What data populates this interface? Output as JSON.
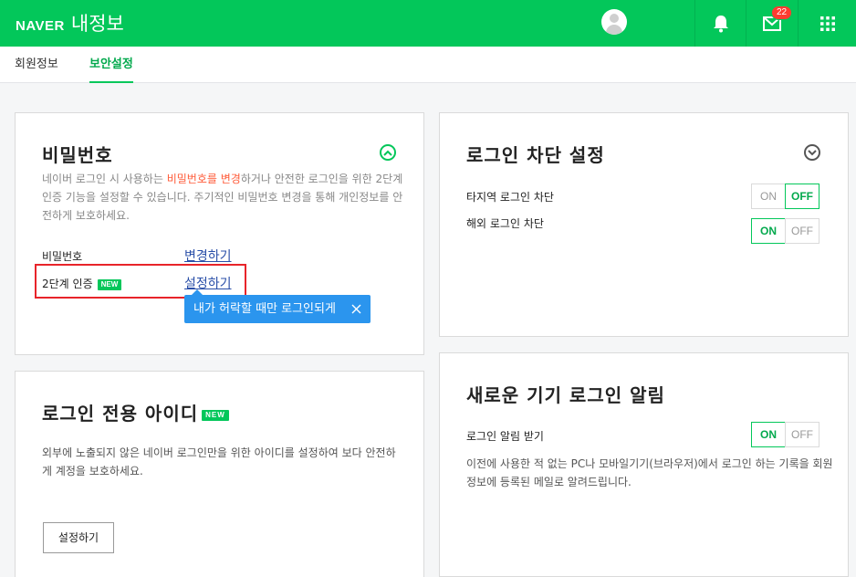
{
  "header": {
    "brand": "NAVER",
    "title": "내정보",
    "mail_count": "22",
    "colors": {
      "primary": "#03c75a",
      "badge": "#ff3b30"
    }
  },
  "tabs": [
    {
      "label": "회원정보"
    },
    {
      "label": "보안설정"
    }
  ],
  "password_card": {
    "title": "비밀번호",
    "desc_before": "네이버 로그인 시 사용하는 ",
    "desc_highlight": "비밀번호를 변경",
    "desc_line1_after": "하거나 안전한 로그인을 위한 2단계",
    "desc_line2": "인증 기능을 설정할 수 있습니다. 주기적인 비밀번호 변경을 통해 개인정보를 안",
    "desc_line3": "전하게 보호하세요.",
    "row1_label": "비밀번호",
    "row1_link": "변경하기",
    "row2_label": "2단계 인증",
    "row2_badge": "NEW",
    "row2_link": "설정하기",
    "tooltip": "내가 허락할 때만 로그인되게"
  },
  "login_id_card": {
    "title": "로그인 전용 아이디",
    "badge": "NEW",
    "desc_line1": "외부에 노출되지 않은 네이버 로그인만을 위한 아이디를 설정하여 보다 안전하",
    "desc_line2": "게 계정을 보호하세요.",
    "button": "설정하기"
  },
  "block_card": {
    "title": "로그인 차단 설정",
    "rows": [
      {
        "label": "타지역 로그인 차단",
        "on": "ON",
        "off": "OFF",
        "selected": "OFF"
      },
      {
        "label": "해외 로그인 차단",
        "on": "ON",
        "off": "OFF",
        "selected": "ON"
      }
    ]
  },
  "alert_card": {
    "title": "새로운 기기 로그인 알림",
    "row_label": "로그인 알림 받기",
    "on": "ON",
    "off": "OFF",
    "selected": "ON",
    "desc_line1": "이전에 사용한 적 없는 PC나 모바일기기(브라우저)에서 로그인 하는 기록을 회원",
    "desc_line2": "정보에 등록된 메일로 알려드립니다."
  }
}
